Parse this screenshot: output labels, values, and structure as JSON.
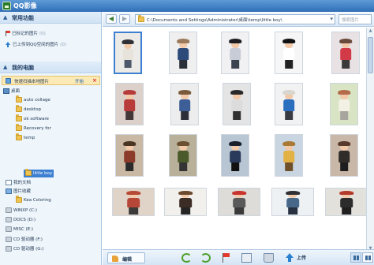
{
  "window": {
    "title": "QQ影像"
  },
  "sidebar": {
    "common_header": "常用功能",
    "common_items": [
      {
        "label": "已标记的图片",
        "count": "(0)",
        "icon": "flag-icon"
      },
      {
        "label": "已上传到QQ空间的图片",
        "count": "(0)",
        "icon": "upload-icon"
      }
    ],
    "computer_header": "我的电脑",
    "quick_scan": {
      "label": "快速扫描本地图片",
      "action": "开始",
      "close": "×"
    },
    "tree": {
      "desktop": "桌面",
      "desktop_children": [
        "auto collage",
        "desktop",
        "ok software",
        "Recovery for",
        "temp"
      ],
      "temp_child": "little boy",
      "my_docs": "我的文档",
      "pic_fav": "图片收藏",
      "pic_fav_child": "Kea Coloring",
      "drives": [
        "WINXP (C:)",
        "DOCS (D:)",
        "MISC (E:)",
        "CD 驱动器 (F:)",
        "CD 驱动器 (G:)"
      ]
    }
  },
  "toolbar": {
    "back": "◀",
    "forward": "▶",
    "path": "C:\\Documents and Settings\\Administrator\\桌面\\temp\\little boy\\",
    "search_placeholder": "搜索图片"
  },
  "photos": [
    {
      "hat": "#2f3136",
      "shirt": "#e7e3da",
      "legs": "#4e5a6c",
      "bg": "#ecebe8"
    },
    {
      "hat": "#9a7a5a",
      "shirt": "#2c4b7a",
      "legs": "#2a2f3a",
      "bg": "#efefef"
    },
    {
      "hat": "#1d1d22",
      "shirt": "#c8ccd6",
      "legs": "#3b4250",
      "bg": "#f1f1f3"
    },
    {
      "hat": "#111111",
      "shirt": "#ffffff",
      "legs": "#222222",
      "bg": "#f6f6f6"
    },
    {
      "hat": "#6a4a3a",
      "shirt": "#d33a48",
      "legs": "#3a3a3a",
      "bg": "#e8e2e4"
    },
    {
      "hat": "#b53a3a",
      "shirt": "#b73c3a",
      "legs": "#433838",
      "bg": "#dcd0cb"
    },
    {
      "hat": "#7a5a3a",
      "shirt": "#3d5e96",
      "legs": "#2c2f38",
      "bg": "#ededed"
    },
    {
      "hat": "#2a2a2a",
      "shirt": "#dcdcdc",
      "legs": "#303030",
      "bg": "#e4e4e4"
    },
    {
      "hat": "#d8d6cf",
      "shirt": "#2d6fbf",
      "legs": "#3a3a42",
      "bg": "#f2f2f2"
    },
    {
      "hat": "#b46b4a",
      "shirt": "#f3f0e6",
      "legs": "#a7a59d",
      "bg": "#d8e4c4"
    },
    {
      "hat": "#4a3422",
      "shirt": "#8c3a2a",
      "legs": "#2b2b2b",
      "bg": "#c9b8a3"
    },
    {
      "hat": "#6a5030",
      "shirt": "#4a5a2a",
      "legs": "#333333",
      "bg": "#b9b09a"
    },
    {
      "hat": "#1a1f2a",
      "shirt": "#2a3a5a",
      "legs": "#111111",
      "bg": "#b8c6d3"
    },
    {
      "hat": "#a87a36",
      "shirt": "#e2b247",
      "legs": "#705028",
      "bg": "#c9d6e2"
    },
    {
      "hat": "#5a3a2a",
      "shirt": "#2f2c2a",
      "legs": "#1e1e1e",
      "bg": "#c9b7a8"
    },
    {
      "hat": "#b64a36",
      "shirt": "#b54638",
      "legs": "#3a3a3a",
      "bg": "#e0d3c7"
    },
    {
      "hat": "#6b4a30",
      "shirt": "#3b2c26",
      "legs": "#252525",
      "bg": "#f1f0ed"
    },
    {
      "hat": "#c8342e",
      "shirt": "#5a5a5a",
      "legs": "#3a3a3a",
      "bg": "#dddcd8"
    },
    {
      "hat": "#2f2f33",
      "shirt": "#48688a",
      "legs": "#263040",
      "bg": "#eef1f4"
    },
    {
      "hat": "#b43a2c",
      "shirt": "#2c2c2c",
      "legs": "#1f1f1f",
      "bg": "#e3e1dc"
    }
  ],
  "bottombar": {
    "edit": "编辑",
    "upload": "上传"
  }
}
